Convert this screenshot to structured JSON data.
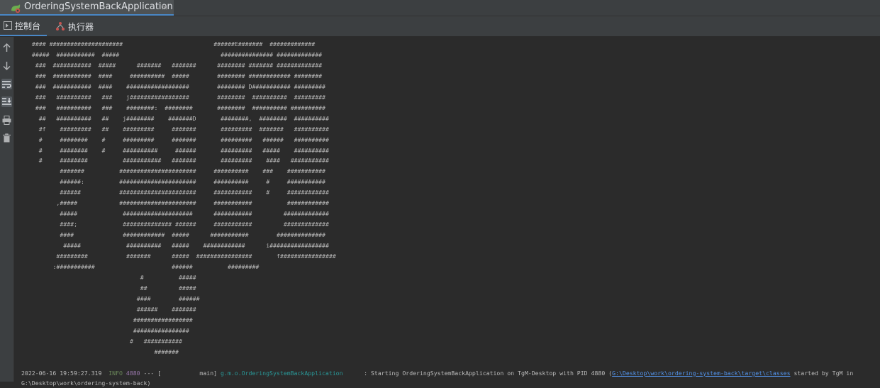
{
  "tab": {
    "title": "OrderingSystemBackApplication",
    "close_glyph": "×",
    "icon": "spring-boot-run-icon"
  },
  "toolbar": {
    "console_label": "控制台",
    "executor_label": "执行器"
  },
  "sidebar": {
    "items": [
      {
        "icon": "arrow-up-icon"
      },
      {
        "icon": "arrow-down-icon"
      },
      {
        "icon": "soft-wrap-icon",
        "active": true
      },
      {
        "icon": "scroll-to-end-icon",
        "active": true
      },
      {
        "icon": "print-icon"
      },
      {
        "icon": "trash-icon"
      }
    ]
  },
  "console": {
    "banner": " #### #####################                          ######E#######  #############\n #####  ###########  #####                             ############### #############\n  ###  ###########  #####      #######   #######      ######## ####### #############\n  ###  ###########  ####     ##########  #####        ######## ############ ########\n  ###  ###########  ####    ##################        ######## D########### #########\n  ###   ##########   ###    j#################        ########  ##########  #########\n  ###   ##########   ###    ########:  ########       ########  ########## ##########\n   ##   ##########   ##    j########    #######D       ########,  ########  ##########\n   #f    #########   ##    #########     #######       #########  #######   ##########\n   #     ########    #     #########     #######       #########   ######   ##########\n   #     ########    #     ##########     ######       #########   #####    ##########\n   #     ########          ###########   #######       #########    ####   ###########\n         #######          ######################     ##########    ###    ###########\n         ######:          ######################     ##########     #     ###########\n         ######           ######################     ###########    #     ############\n        ,#####            ######################     ###########          ############\n         #####             ####################      ###########         #############\n         ####;             ############## ######     ###########         #############\n         ####              ############  #####      ###########        ##############\n          #####             ##########   #####    ############      i#################\n        #########           #######      #####  ################       f################\n       :###########                      ######          #########\n                                #          #####\n                                ##         #####\n                               ####        ######\n                               ######    #######\n                              #################\n                              ################\n                             #   ###########\n                                    #######",
    "log": {
      "timestamp": "2022-06-16 19:59:27.319",
      "level": "INFO",
      "pid": "4880",
      "separator": "--- [",
      "thread": "           main]",
      "logger": "g.m.o.OrderingSystemBackApplication",
      "message_prefix": "      : Starting OrderingSystemBackApplication on TgM-Desktop with PID 4880 (",
      "path": "G:\\Desktop\\work\\ordering-system-back\\target\\classes",
      "message_suffix": " started by TgM in",
      "continuation": "G:\\Desktop\\work\\ordering-system-back)"
    }
  },
  "colors": {
    "background": "#2b2b2b",
    "toolbar": "#3c3f41",
    "accent": "#4a88c7",
    "info": "#6a8759",
    "logger": "#299999",
    "link": "#5394ec"
  }
}
